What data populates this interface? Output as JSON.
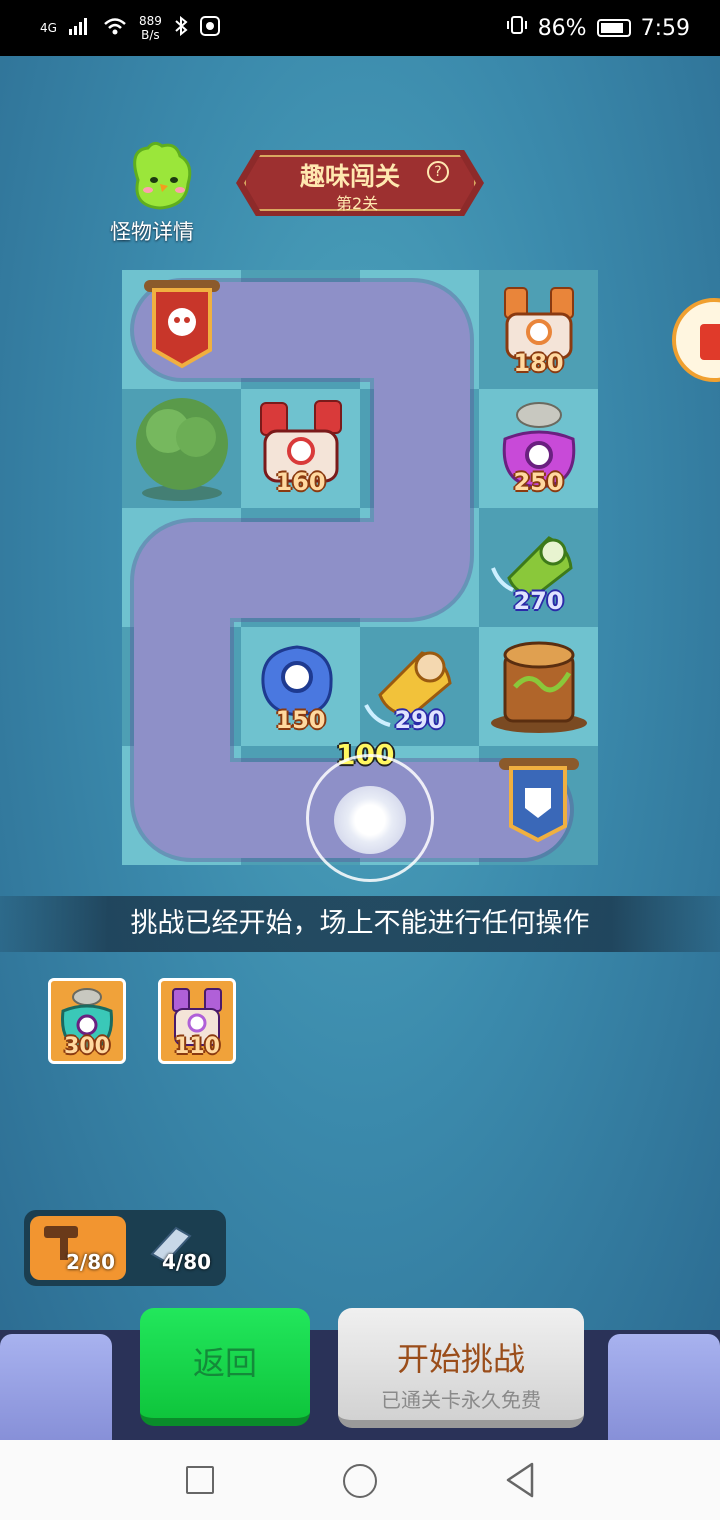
{
  "status_bar": {
    "network": "4G",
    "speed_value": "889",
    "speed_unit": "B/s",
    "battery_percent": "86%",
    "time": "7:59"
  },
  "monster": {
    "label": "怪物详情",
    "icon": "cactus-monster-icon"
  },
  "banner": {
    "title": "趣味闯关",
    "help_glyph": "?",
    "subtitle": "第2关"
  },
  "board": {
    "towers": [
      {
        "icon": "skull-banner-icon",
        "value": ""
      },
      {
        "icon": "dice-tower-icon",
        "value": "180"
      },
      {
        "icon": "tree-icon",
        "value": ""
      },
      {
        "icon": "dice-tower-icon",
        "value": "160"
      },
      {
        "icon": "rock-pot-tower-icon",
        "value": "250"
      },
      {
        "icon": "green-bell-tower-icon",
        "value": "270"
      },
      {
        "icon": "blue-pot-tower-icon",
        "value": "150"
      },
      {
        "icon": "yellow-bell-tower-icon",
        "value": "290"
      },
      {
        "icon": "tree-stump-icon",
        "value": ""
      },
      {
        "icon": "shield-banner-icon",
        "value": ""
      }
    ],
    "floating_score": "100"
  },
  "message": "挑战已经开始，场上不能进行任何操作",
  "cards": [
    {
      "icon": "rock-pot-tower-icon",
      "value": "300"
    },
    {
      "icon": "dice-tower-icon",
      "value": "110"
    }
  ],
  "counters": [
    {
      "icon": "hammer-icon",
      "value": "2/80"
    },
    {
      "icon": "ticket-icon",
      "value": "4/80"
    }
  ],
  "buttons": {
    "back": "返回",
    "start_title": "开始挑战",
    "start_sub": "已通关卡永久免费"
  },
  "side_badge": {
    "text": "领红包"
  },
  "colors": {
    "accent_green": "#18d74c",
    "banner_red": "#9d3030",
    "path_purple": "#8e90c8"
  }
}
